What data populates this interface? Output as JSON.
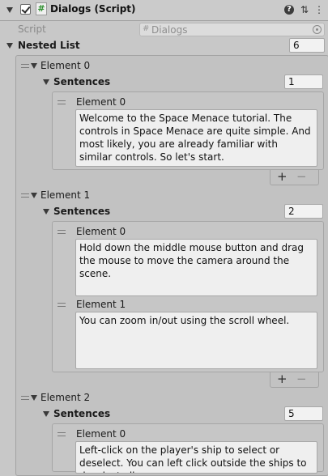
{
  "header": {
    "title": "Dialogs (Script)",
    "script_glyph": "#",
    "help_glyph": "?",
    "presets_glyph": "⇅",
    "menu_glyph": "⋮"
  },
  "script_field": {
    "label": "Script",
    "value": "Dialogs"
  },
  "nested_list": {
    "label": "Nested List",
    "size": "6",
    "elements": [
      {
        "label": "Element 0",
        "sentences_label": "Sentences",
        "size": "1",
        "items": [
          {
            "label": "Element 0",
            "text": "Welcome to the Space Menace tutorial. The controls in Space Menace are quite simple. And most likely, you are already familiar with similar controls. So let's start."
          }
        ]
      },
      {
        "label": "Element 1",
        "sentences_label": "Sentences",
        "size": "2",
        "items": [
          {
            "label": "Element 0",
            "text": "Hold down the middle mouse button and drag the mouse to move the camera around the scene."
          },
          {
            "label": "Element 1",
            "text": "You can zoom in/out using the scroll wheel."
          }
        ]
      },
      {
        "label": "Element 2",
        "sentences_label": "Sentences",
        "size": "5",
        "items": [
          {
            "label": "Element 0",
            "text": "Left-click on the player's ship to select or deselect. You can left click outside the ships to deselect all"
          }
        ]
      }
    ]
  },
  "footer_buttons": {
    "add": "+",
    "remove": "−"
  }
}
